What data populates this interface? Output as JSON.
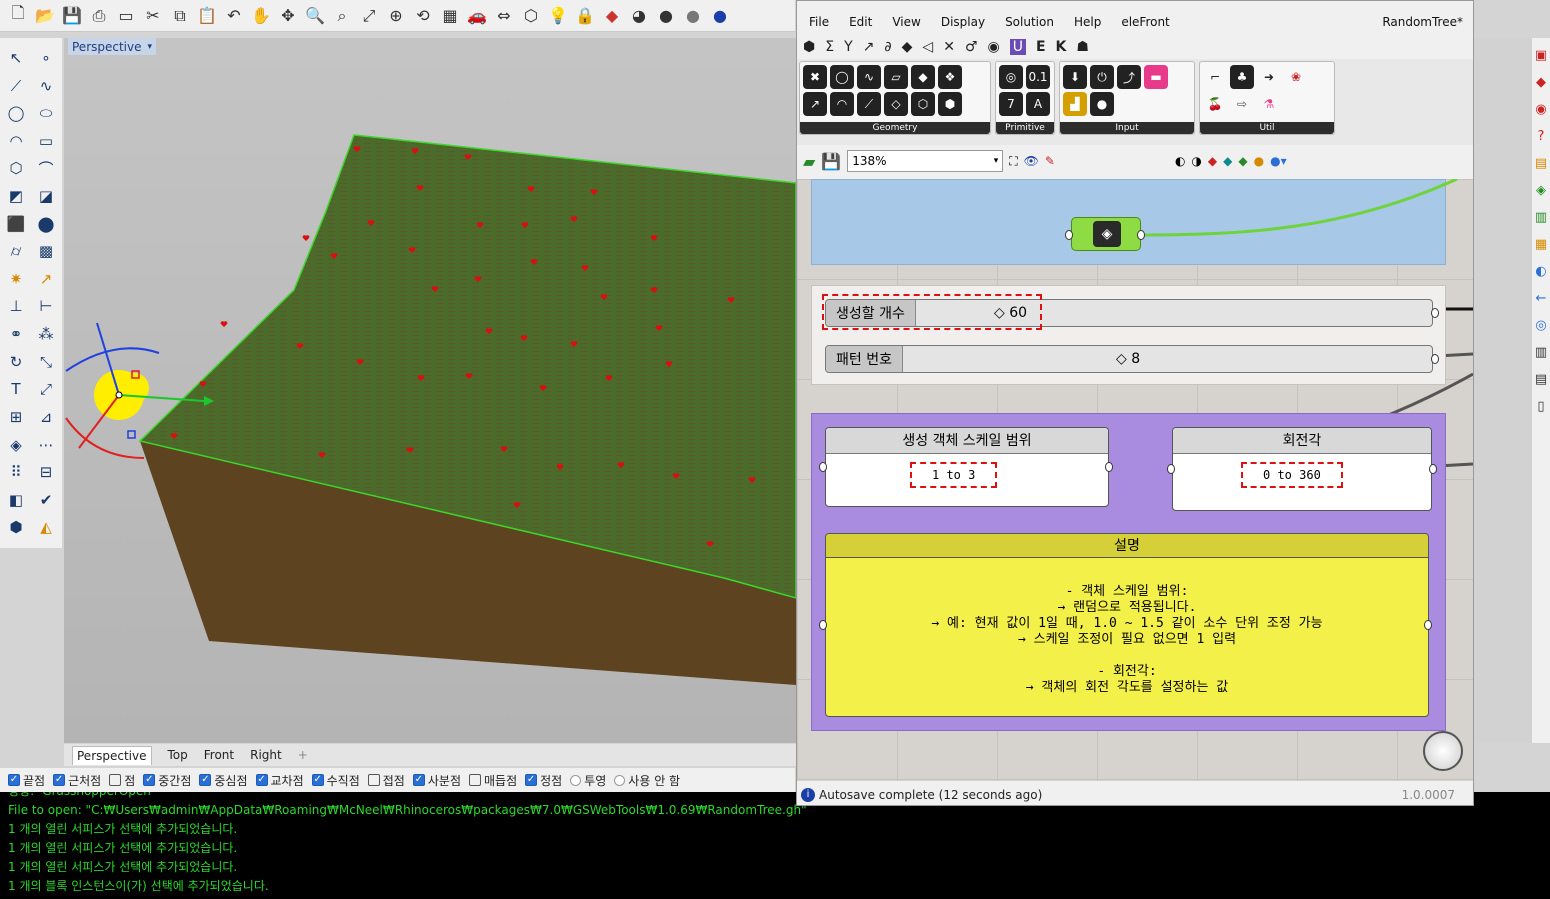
{
  "rhino": {
    "toolbar_icons": [
      "new-file-icon",
      "open-icon",
      "save-icon",
      "print-icon",
      "page-setup-icon",
      "cut-icon",
      "copy-icon",
      "paste-icon",
      "undo-icon",
      "pan-icon",
      "move-icon",
      "zoom-icon",
      "zoom-window-icon",
      "zoom-extents-icon",
      "zoom-selected-icon",
      "rotate-view-icon",
      "grid-icon",
      "car-icon",
      "dimension-icon",
      "polygon-icon",
      "light-icon",
      "lock-icon",
      "layer-icon",
      "color-wheel-icon",
      "render-sphere-icon",
      "material-sphere-icon",
      "environment-sphere-icon"
    ],
    "viewport": {
      "title": "Perspective",
      "tabs": [
        "Perspective",
        "Top",
        "Front",
        "Right"
      ],
      "active_tab": "Perspective",
      "add_tab_icon": "+"
    },
    "osnap": [
      {
        "label": "끝점",
        "checked": true
      },
      {
        "label": "근처점",
        "checked": true
      },
      {
        "label": "점",
        "checked": false
      },
      {
        "label": "중간점",
        "checked": true
      },
      {
        "label": "중심점",
        "checked": true
      },
      {
        "label": "교차점",
        "checked": true
      },
      {
        "label": "수직점",
        "checked": true
      },
      {
        "label": "접점",
        "checked": false
      },
      {
        "label": "사분점",
        "checked": true
      },
      {
        "label": "매듭점",
        "checked": false
      },
      {
        "label": "정점",
        "checked": true
      },
      {
        "label": "투영",
        "radio": true
      },
      {
        "label": "사용 안 함",
        "radio": true
      }
    ],
    "command_lines": [
      "명령: -GrasshopperOpen",
      "File to open: \"C:₩Users₩admin₩AppData₩Roaming₩McNeel₩Rhinoceros₩packages₩7.0₩GSWebTools₩1.0.69₩RandomTree.gh\"",
      "1 개의 열린 서피스가 선택에 추가되었습니다.",
      "1 개의 열린 서피스가 선택에 추가되었습니다.",
      "1 개의 열린 서피스가 선택에 추가되었습니다.",
      "1 개의 블록 인스턴스이(가) 선택에 추가되었습니다."
    ]
  },
  "grasshopper": {
    "menu": [
      "File",
      "Edit",
      "View",
      "Display",
      "Solution",
      "Help",
      "eleFront"
    ],
    "document_title": "RandomTree*",
    "tab_icons": [
      "params-tab-icon",
      "maths-tab-icon",
      "sets-tab-icon",
      "vector-tab-icon",
      "curve-tab-icon",
      "surface-tab-icon",
      "mesh-tab-icon",
      "intersect-tab-icon",
      "transform-tab-icon",
      "display-tab-icon"
    ],
    "ribbon_groups": [
      {
        "label": "Geometry",
        "icon_count": 12
      },
      {
        "label": "Primitive",
        "icon_count": 4
      },
      {
        "label": "Input",
        "icon_count": 6
      },
      {
        "label": "Util",
        "icon_count": 8
      }
    ],
    "zoom": "138%",
    "status": "Autosave complete (12 seconds ago)",
    "version": "1.0.0007",
    "sliders": [
      {
        "label": "생성할 개수",
        "value": "◇ 60"
      },
      {
        "label": "패턴 번호",
        "value": "◇ 8"
      }
    ],
    "panels": [
      {
        "title": "생성 객체 스케일 범위",
        "value": "1 to 3"
      },
      {
        "title": "회전각",
        "value": "0 to 360"
      }
    ],
    "note": {
      "title": "설명",
      "lines": [
        "- 객체 스케일 범위:",
        "→ 랜덤으로 적용됩니다.",
        "→ 예: 현재 값이 1일 때, 1.0 ~ 1.5 같이 소수 단위 조정 가능",
        "→ 스케일 조정이 필요 없으면 1 입력",
        "",
        "- 회전각:",
        "→ 객체의 회전 각도를 설정하는 값"
      ]
    }
  },
  "colors": {
    "grass": "#4a6b2a",
    "soil": "#5f4420",
    "tree_dots": "#d81010",
    "cluster_bg": "#a7c8e7",
    "group_purple": "#a98be0",
    "note_yellow": "#f4f04a",
    "console_green": "#2bd82b"
  }
}
